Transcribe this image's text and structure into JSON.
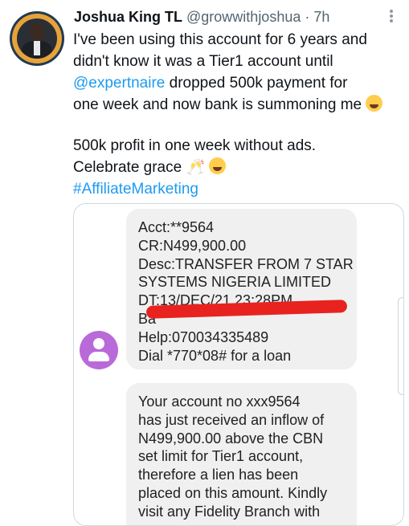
{
  "tweet": {
    "author_name": "Joshua King TL",
    "handle": "@growwithjoshua",
    "separator": "·",
    "time": "7h",
    "lines": [
      "I've been using this account for 6 years and",
      "didn't know it was a Tier1 account until",
      "dropped 500k payment for",
      "one week and now bank is summoning me",
      "500k profit in one week without ads.",
      "Celebrate grace"
    ],
    "mention": "@expertnaire",
    "hashtag": "#AffiliateMarketing",
    "emoji_grin": "grinning-sweat-emoji",
    "emoji_cheers": "clinking-glasses-emoji"
  },
  "sms": {
    "message1": [
      "Acct:**9564",
      "CR:N499,900.00",
      "Desc:TRANSFER FROM 7 STAR",
      "SYSTEMS NIGERIA LIMITED",
      "DT:13/DEC/21 23:28PM",
      "Ba",
      "Help:070034335489",
      "Dial *770*08# for a loan"
    ],
    "message2": [
      "Your account no xxx9564",
      "has just received an inflow of",
      "N499,900.00 above the CBN",
      "set limit for Tier1 account,",
      "therefore a lien has been",
      "placed on this amount. Kindly",
      "visit any Fidelity Branch with"
    ]
  },
  "colors": {
    "link": "#1d9bf0",
    "text": "#0f1419",
    "muted": "#536471",
    "bubble": "#f0f0f0",
    "contact_avatar": "#b96ad9",
    "redaction": "#e8231f"
  }
}
